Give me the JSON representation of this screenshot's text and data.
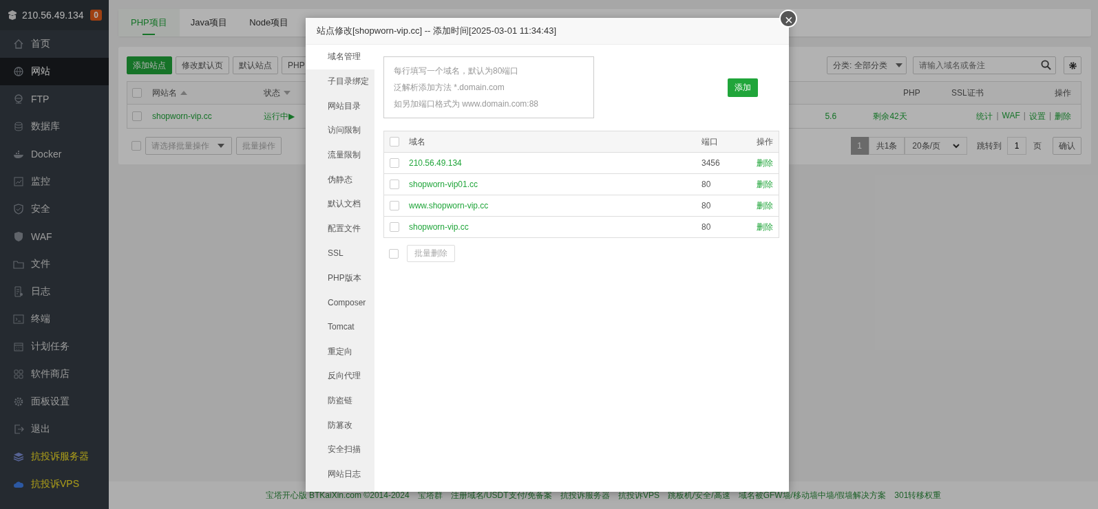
{
  "sidebar": {
    "server": "210.56.49.134",
    "badge": "0",
    "items": [
      {
        "label": "首页",
        "selected": false,
        "kind": "normal"
      },
      {
        "label": "网站",
        "selected": true,
        "kind": "normal"
      },
      {
        "label": "FTP",
        "selected": false,
        "kind": "normal"
      },
      {
        "label": "数据库",
        "selected": false,
        "kind": "normal"
      },
      {
        "label": "Docker",
        "selected": false,
        "kind": "normal"
      },
      {
        "label": "监控",
        "selected": false,
        "kind": "normal"
      },
      {
        "label": "安全",
        "selected": false,
        "kind": "normal"
      },
      {
        "label": "WAF",
        "selected": false,
        "kind": "normal"
      },
      {
        "label": "文件",
        "selected": false,
        "kind": "normal"
      },
      {
        "label": "日志",
        "selected": false,
        "kind": "normal"
      },
      {
        "label": "终端",
        "selected": false,
        "kind": "normal"
      },
      {
        "label": "计划任务",
        "selected": false,
        "kind": "normal"
      },
      {
        "label": "软件商店",
        "selected": false,
        "kind": "normal"
      },
      {
        "label": "面板设置",
        "selected": false,
        "kind": "normal"
      },
      {
        "label": "退出",
        "selected": false,
        "kind": "normal"
      },
      {
        "label": "抗投诉服务器",
        "selected": false,
        "kind": "promo"
      },
      {
        "label": "抗投诉VPS",
        "selected": false,
        "kind": "promo"
      }
    ]
  },
  "tabs": [
    {
      "label": "PHP项目",
      "selected": true
    },
    {
      "label": "Java项目",
      "selected": false
    },
    {
      "label": "Node项目",
      "selected": false
    }
  ],
  "toolbar": {
    "buttons": [
      {
        "label": "添加站点",
        "kind": "primary"
      },
      {
        "label": "修改默认页",
        "kind": "plain"
      },
      {
        "label": "默认站点",
        "kind": "plain"
      },
      {
        "label": "PHP",
        "kind": "plain"
      }
    ],
    "category": "分类: 全部分类",
    "search": {
      "placeholder": "请输入域名或备注"
    }
  },
  "sites_table": {
    "select_all_checked": false,
    "columns": [
      {
        "label": "网站名",
        "sort_ascending": true
      },
      {
        "label": "状态",
        "sort_ascending": false
      },
      {
        "label": "PHP"
      },
      {
        "label": "SSL证书"
      },
      {
        "label": "操作"
      }
    ],
    "rows": [
      {
        "checked": false,
        "name": "shopworn-vip.cc",
        "status": "运行中▶",
        "php": "5.6",
        "ssl": "剩余42天",
        "actions": [
          "统计",
          "WAF",
          "设置",
          "删除"
        ],
        "separators": [
          "|",
          "|",
          "|"
        ]
      }
    ]
  },
  "batch": {
    "checked": false,
    "placeholder": "请选择批量操作",
    "button": "批量操作"
  },
  "pagination": {
    "current": "1",
    "total": "共1条",
    "page_size": "20条/页",
    "jump_label": "跳转到",
    "jump_value": "1",
    "page_unit": "页",
    "confirm": "确认"
  },
  "footer": [
    "宝塔开心版 BTKaiXin.com ©2014-2024",
    "宝塔群",
    "注册域名/USDT支付/免备案",
    "抗投诉服务器",
    "抗投诉VPS",
    "跳板机/安全/高速",
    "域名被GFW墙/移动墙中墙/假墙解决方案",
    "301转移权重"
  ],
  "modal": {
    "title": "站点修改[shopworn-vip.cc] -- 添加时间[2025-03-01 11:34:43]",
    "close": "×",
    "nav": [
      {
        "label": "域名管理",
        "selected": true
      },
      {
        "label": "子目录绑定",
        "selected": false
      },
      {
        "label": "网站目录",
        "selected": false
      },
      {
        "label": "访问限制",
        "selected": false
      },
      {
        "label": "流量限制",
        "selected": false
      },
      {
        "label": "伪静态",
        "selected": false
      },
      {
        "label": "默认文档",
        "selected": false
      },
      {
        "label": "配置文件",
        "selected": false
      },
      {
        "label": "SSL",
        "selected": false
      },
      {
        "label": "PHP版本",
        "selected": false
      },
      {
        "label": "Composer",
        "selected": false
      },
      {
        "label": "Tomcat",
        "selected": false
      },
      {
        "label": "重定向",
        "selected": false
      },
      {
        "label": "反向代理",
        "selected": false
      },
      {
        "label": "防盗链",
        "selected": false
      },
      {
        "label": "防篡改",
        "selected": false
      },
      {
        "label": "安全扫描",
        "selected": false
      },
      {
        "label": "网站日志",
        "selected": false
      }
    ],
    "domain_input": {
      "placeholder": [
        "每行填写一个域名，默认为80端口",
        "泛解析添加方法 *.domain.com",
        "如另加端口格式为 www.domain.com:88"
      ]
    },
    "select_all_checked": false,
    "add_button": "添加",
    "domain_columns": [
      "域名",
      "端口",
      "操作"
    ],
    "domains": [
      {
        "checked": false,
        "domain": "210.56.49.134",
        "port": "3456",
        "action": "删除"
      },
      {
        "checked": false,
        "domain": "shopworn-vip01.cc",
        "port": "80",
        "action": "删除"
      },
      {
        "checked": false,
        "domain": "www.shopworn-vip.cc",
        "port": "80",
        "action": "删除"
      },
      {
        "checked": false,
        "domain": "shopworn-vip.cc",
        "port": "80",
        "action": "删除"
      }
    ],
    "batch_checked": false,
    "batch_delete": "批量删除"
  }
}
